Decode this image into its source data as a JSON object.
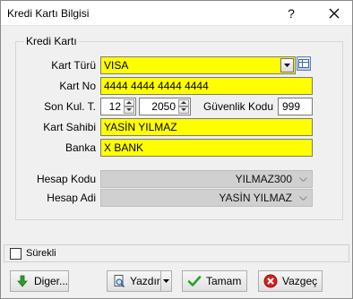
{
  "window": {
    "title": "Kredi Kartı Bilgisi",
    "help_label": "?"
  },
  "group": {
    "title": "Kredi Kartı"
  },
  "form": {
    "kart_turu_label": "Kart Türü",
    "kart_turu_value": "VISA",
    "kart_no_label": "Kart No",
    "kart_no_value": "4444 4444 4444 4444",
    "son_kul_label": "Son Kul. T.",
    "son_kul_month": "12",
    "son_kul_year": "2050",
    "guvenlik_label": "Güvenlik Kodu",
    "guvenlik_value": "999",
    "kart_sahibi_label": "Kart Sahibi",
    "kart_sahibi_value": "YASİN YILMAZ",
    "banka_label": "Banka",
    "banka_value": "X BANK",
    "hesap_kodu_label": "Hesap Kodu",
    "hesap_kodu_value": "YILMAZ300",
    "hesap_adi_label": "Hesap Adi",
    "hesap_adi_value": "YASİN YILMAZ"
  },
  "footer": {
    "surekli_label": "Sürekli",
    "surekli_checked": false,
    "diger_label": "Diger...",
    "yazdir_label": "Yazdır",
    "tamam_label": "Tamam",
    "vazgec_label": "Vazgeç"
  },
  "colors": {
    "required_field": "#ffff00",
    "disabled_field": "#d0d0d0",
    "window_bg": "#f0f0f0"
  },
  "icons": {
    "diger": "green-down-arrow-icon",
    "yazdir": "printer-preview-icon",
    "tamam": "green-check-icon",
    "vazgec": "red-cancel-icon",
    "lookup": "lookup-table-icon"
  }
}
